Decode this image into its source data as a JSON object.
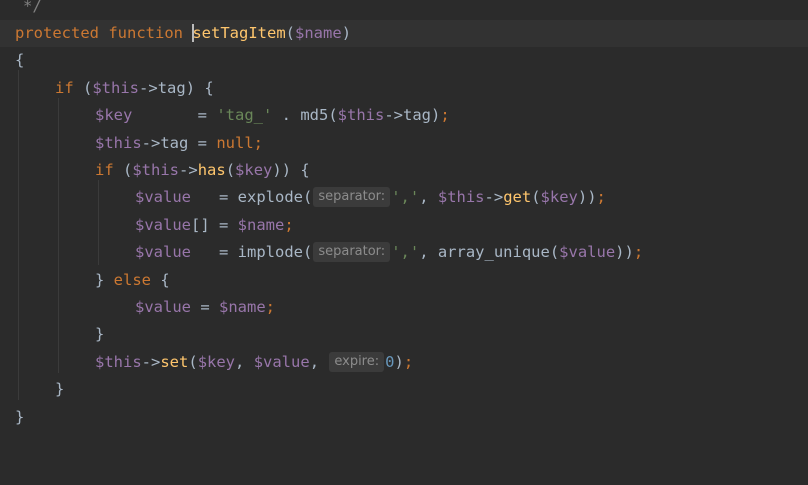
{
  "editor": {
    "lines": {
      "l1": {
        "comment": "*/"
      },
      "l2": {
        "modifier": "protected",
        "keyword": "function",
        "name": "setTagItem",
        "open": "(",
        "param": "$name",
        "close": ")"
      },
      "l3": {
        "brace": "{"
      },
      "l4": {
        "kw_if": "if",
        "open": " (",
        "var_this": "$this",
        "arrow": "->",
        "prop": "tag",
        "close": ") {"
      },
      "l5": {
        "var_key": "$key",
        "pad": "       = ",
        "str": "'tag_'",
        "mid": " . md5(",
        "var_this": "$this",
        "arrow": "->",
        "prop": "tag",
        "close": ")",
        "semi": ";"
      },
      "l6": {
        "var_this": "$this",
        "arrow": "->",
        "prop": "tag",
        "eq": " = ",
        "null": "null",
        "semi": ";"
      },
      "l7": {
        "kw_if": "if",
        "open": " (",
        "var_this": "$this",
        "arrow": "->",
        "method": "has",
        "paren": "(",
        "var_key": "$key",
        "close": ")) {"
      },
      "l8": {
        "var_value": "$value",
        "pad": "   = explode(",
        "hint": "separator:",
        "str": "','",
        "comma": ", ",
        "var_this": "$this",
        "arrow": "->",
        "method": "get",
        "paren": "(",
        "var_key": "$key",
        "close": "))",
        "semi": ";"
      },
      "l9": {
        "var_value": "$value",
        "brackets": "[] = ",
        "var_name": "$name",
        "semi": ";"
      },
      "l10": {
        "var_value": "$value",
        "pad": "   = implode(",
        "hint": "separator:",
        "str": "','",
        "comma": ", array_unique(",
        "var_value2": "$value",
        "close": "))",
        "semi": ";"
      },
      "l11": {
        "close": "} ",
        "kw_else": "else",
        "open": " {"
      },
      "l12": {
        "var_value": "$value",
        "eq": " = ",
        "var_name": "$name",
        "semi": ";"
      },
      "l13": {
        "brace": "}"
      },
      "l14": {
        "var_this": "$this",
        "arrow": "->",
        "method": "set",
        "paren": "(",
        "var_key": "$key",
        "comma": ", ",
        "var_value": "$value",
        "comma2": ", ",
        "hint": "expire:",
        "num": "0",
        "close": ")",
        "semi": ";"
      },
      "l15": {
        "brace": "}"
      },
      "l16": {
        "brace": "}"
      }
    }
  },
  "colors": {
    "background": "#2b2b2b",
    "current_line": "#323232",
    "keyword": "#cc7832",
    "function_name": "#ffc66d",
    "variable": "#9876aa",
    "string": "#6a8759",
    "number": "#6897bb",
    "comment": "#808080",
    "default_text": "#a9b7c6"
  }
}
